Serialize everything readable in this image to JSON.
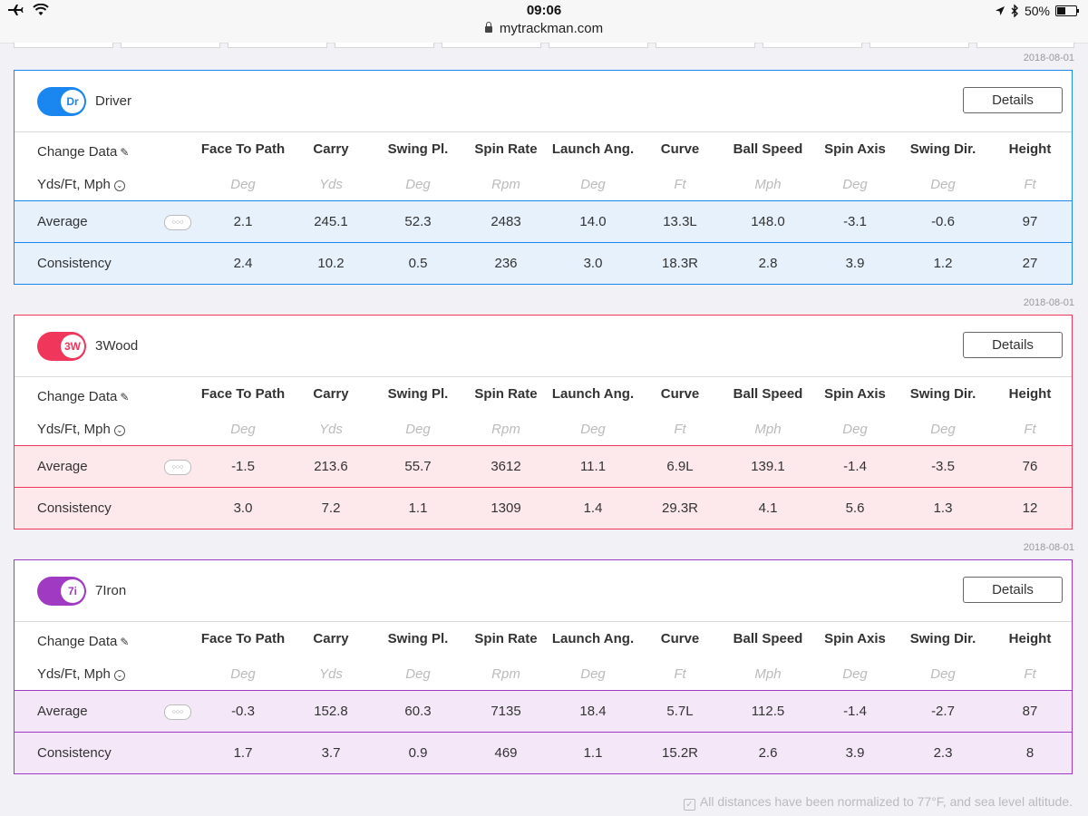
{
  "statusbar": {
    "time": "09:06",
    "url": "mytrackman.com",
    "battery": "50%",
    "battery_level": 0.5
  },
  "columns": [
    {
      "name": "Face To Path",
      "unit": "Deg"
    },
    {
      "name": "Carry",
      "unit": "Yds"
    },
    {
      "name": "Swing Pl.",
      "unit": "Deg"
    },
    {
      "name": "Spin Rate",
      "unit": "Rpm"
    },
    {
      "name": "Launch Ang.",
      "unit": "Deg"
    },
    {
      "name": "Curve",
      "unit": "Ft"
    },
    {
      "name": "Ball Speed",
      "unit": "Mph"
    },
    {
      "name": "Spin Axis",
      "unit": "Deg"
    },
    {
      "name": "Swing Dir.",
      "unit": "Deg"
    },
    {
      "name": "Height",
      "unit": "Ft"
    }
  ],
  "labels": {
    "change_data": "Change Data",
    "units": "Yds/Ft, Mph",
    "average": "Average",
    "consistency": "Consistency",
    "details": "Details"
  },
  "clubs": [
    {
      "date": "2018-08-01",
      "abbr": "Dr",
      "name": "Driver",
      "color": "#1a86f0",
      "tint": "#e6f1fc",
      "average": [
        "2.1",
        "245.1",
        "52.3",
        "2483",
        "14.0",
        "13.3L",
        "148.0",
        "-3.1",
        "-0.6",
        "97"
      ],
      "consistency": [
        "2.4",
        "10.2",
        "0.5",
        "236",
        "3.0",
        "18.3R",
        "2.8",
        "3.9",
        "1.2",
        "27"
      ]
    },
    {
      "date": "2018-08-01",
      "abbr": "3W",
      "name": "3Wood",
      "color": "#f0365a",
      "tint": "#fde8ec",
      "average": [
        "-1.5",
        "213.6",
        "55.7",
        "3612",
        "11.1",
        "6.9L",
        "139.1",
        "-1.4",
        "-3.5",
        "76"
      ],
      "consistency": [
        "3.0",
        "7.2",
        "1.1",
        "1309",
        "1.4",
        "29.3R",
        "4.1",
        "5.6",
        "1.3",
        "12"
      ]
    },
    {
      "date": "2018-08-01",
      "abbr": "7i",
      "name": "7Iron",
      "color": "#a13ac3",
      "tint": "#f4e8f8",
      "average": [
        "-0.3",
        "152.8",
        "60.3",
        "7135",
        "18.4",
        "5.7L",
        "112.5",
        "-1.4",
        "-2.7",
        "87"
      ],
      "consistency": [
        "1.7",
        "3.7",
        "0.9",
        "469",
        "1.1",
        "15.2R",
        "2.6",
        "3.9",
        "2.3",
        "8"
      ]
    }
  ],
  "footer": "All distances have been normalized to 77°F, and sea level altitude."
}
